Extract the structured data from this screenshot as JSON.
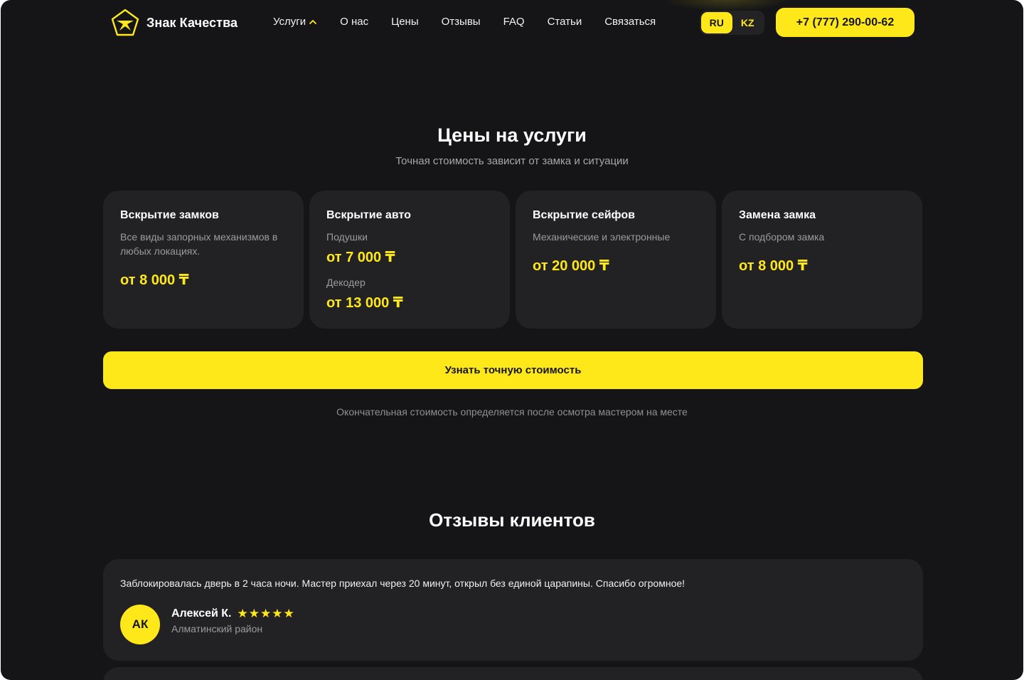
{
  "header": {
    "logo_text": "Знак Качества",
    "nav": [
      {
        "label": "Услуги",
        "dropdown": true
      },
      {
        "label": "О нас"
      },
      {
        "label": "Цены"
      },
      {
        "label": "Отзывы"
      },
      {
        "label": "FAQ"
      },
      {
        "label": "Статьи"
      },
      {
        "label": "Связаться"
      }
    ],
    "languages": [
      {
        "label": "RU",
        "active": true
      },
      {
        "label": "KZ",
        "active": false
      }
    ],
    "phone": "+7 (777) 290-00-62"
  },
  "pricing": {
    "title": "Цены на услуги",
    "subtitle": "Точная стоимость зависит от замка и ситуации",
    "cards": [
      {
        "title": "Вскрытие замков",
        "items": [
          {
            "desc": "Все виды запорных механизмов в любых локациях.",
            "price": "от 8 000 ₸"
          }
        ]
      },
      {
        "title": "Вскрытие авто",
        "items": [
          {
            "desc": "Подушки",
            "price": "от 7 000 ₸"
          },
          {
            "desc": "Декодер",
            "price": "от 13 000 ₸"
          }
        ]
      },
      {
        "title": "Вскрытие сейфов",
        "items": [
          {
            "desc": "Механические и электронные",
            "price": "от 20 000 ₸"
          }
        ]
      },
      {
        "title": "Замена замка",
        "items": [
          {
            "desc": "С подбором замка",
            "price": "от 8 000 ₸"
          }
        ]
      }
    ],
    "cta": "Узнать точную стоимость",
    "note": "Окончательная стоимость определяется после осмотра мастером на месте"
  },
  "reviews": {
    "title": "Отзывы клиентов",
    "items": [
      {
        "text": "Заблокировалась дверь в 2 часа ночи. Мастер приехал через 20 минут, открыл без единой царапины. Спасибо огромное!",
        "initials": "АК",
        "name": "Алексей К.",
        "stars": "★★★★★",
        "rating": 5,
        "location": "Алматинский район"
      }
    ]
  },
  "colors": {
    "accent": "#ffe81a",
    "background": "#151517",
    "card": "#222224"
  }
}
